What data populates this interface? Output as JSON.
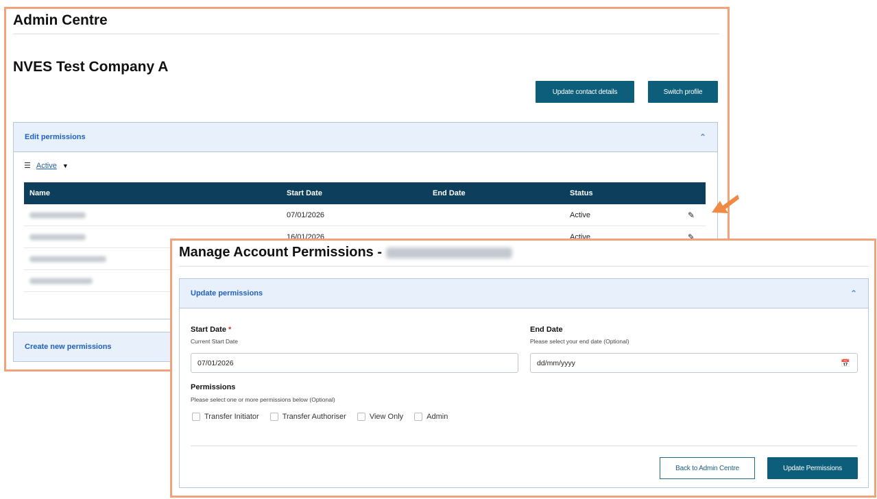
{
  "admin": {
    "title": "Admin Centre",
    "company": "NVES Test Company A",
    "buttons": {
      "update_contact": "Update contact details",
      "switch_profile": "Switch profile"
    },
    "edit_permissions": {
      "header": "Edit permissions",
      "filter_label": "Active",
      "table": {
        "columns": [
          "Name",
          "Start Date",
          "End Date",
          "Status"
        ],
        "rows": [
          {
            "start": "07/01/2026",
            "end": "",
            "status": "Active"
          },
          {
            "start": "16/01/2026",
            "end": "",
            "status": "Active"
          },
          {
            "start": "",
            "end": "",
            "status": ""
          },
          {
            "start": "",
            "end": "",
            "status": ""
          }
        ]
      }
    },
    "create_permissions": "Create new permissions"
  },
  "manage": {
    "title": "Manage Account Permissions -",
    "section_header": "Update permissions",
    "start_date": {
      "label": "Start Date",
      "required_mark": "*",
      "hint": "Current Start Date",
      "value": "07/01/2026"
    },
    "end_date": {
      "label": "End Date",
      "hint": "Please select your end date (Optional)",
      "placeholder": "dd/mm/yyyy"
    },
    "permissions": {
      "label": "Permissions",
      "hint": "Please select one or more permissions below (Optional)",
      "options": [
        "Transfer Initiator",
        "Transfer Authoriser",
        "View Only",
        "Admin"
      ]
    },
    "buttons": {
      "back": "Back to Admin Centre",
      "update": "Update Permissions"
    }
  },
  "colors": {
    "highlight_border": "#f0a37a",
    "primary_button": "#0d5e7a",
    "table_header": "#0d3f5c",
    "accordion_bg": "#e8f1fb",
    "arrow": "#ef8a45"
  }
}
